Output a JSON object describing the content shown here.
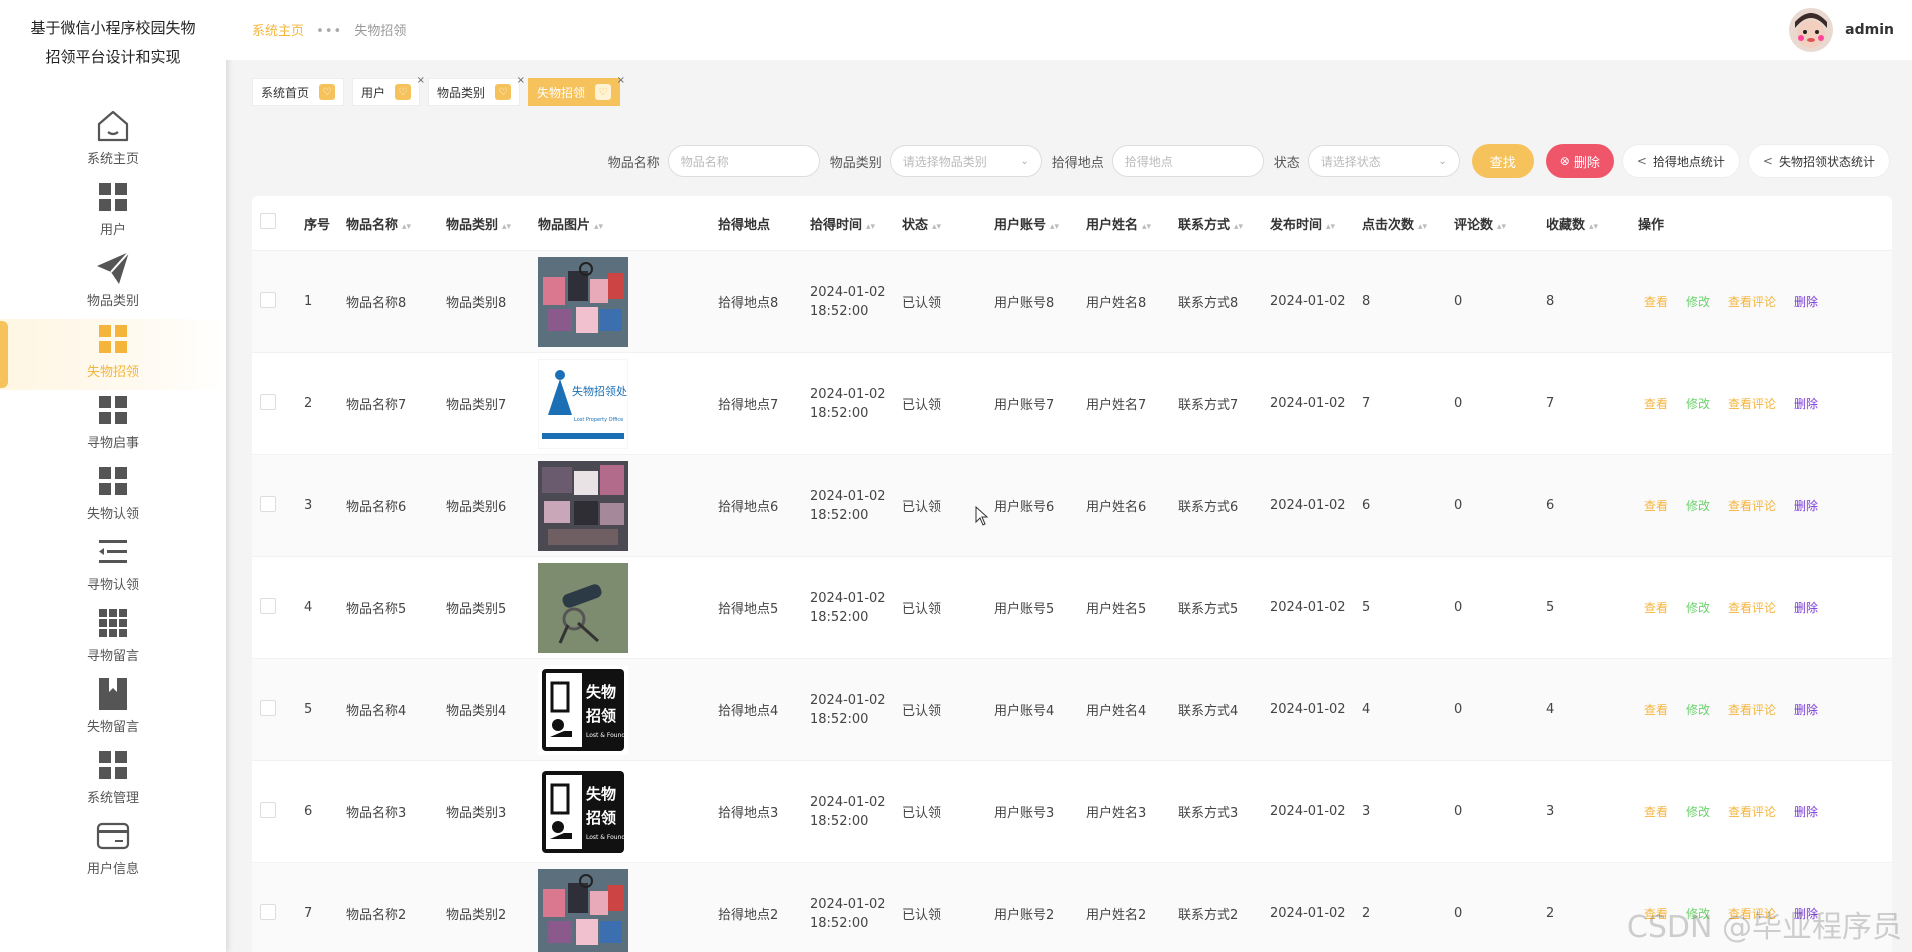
{
  "app": {
    "title_line1": "基于微信小程序校园失物",
    "title_line2": "招领平台设计和实现"
  },
  "sidebar": {
    "items": [
      {
        "label": "系统主页",
        "icon": "home-icon"
      },
      {
        "label": "用户",
        "icon": "grid-icon"
      },
      {
        "label": "物品类别",
        "icon": "send-icon"
      },
      {
        "label": "失物招领",
        "icon": "grid-icon",
        "active": true
      },
      {
        "label": "寻物启事",
        "icon": "grid-icon"
      },
      {
        "label": "失物认领",
        "icon": "grid-icon"
      },
      {
        "label": "寻物认领",
        "icon": "list-icon"
      },
      {
        "label": "寻物留言",
        "icon": "apps-icon"
      },
      {
        "label": "失物留言",
        "icon": "bookmark-icon"
      },
      {
        "label": "系统管理",
        "icon": "grid-icon"
      },
      {
        "label": "用户信息",
        "icon": "card-icon"
      }
    ]
  },
  "breadcrumb": {
    "home": "系统主页",
    "sep": "•••",
    "current": "失物招领"
  },
  "user": {
    "name": "admin"
  },
  "tags": [
    {
      "label": "系统首页"
    },
    {
      "label": "用户",
      "closable": true
    },
    {
      "label": "物品类别",
      "closable": true
    },
    {
      "label": "失物招领",
      "closable": true,
      "active": true
    }
  ],
  "search": {
    "name_label": "物品名称",
    "name_placeholder": "物品名称",
    "category_label": "物品类别",
    "category_placeholder": "请选择物品类别",
    "place_label": "拾得地点",
    "place_placeholder": "拾得地点",
    "status_label": "状态",
    "status_placeholder": "请选择状态",
    "search_btn": "查找",
    "delete_btn": "删除",
    "stat_place_btn": "拾得地点统计",
    "stat_status_btn": "失物招领状态统计"
  },
  "table": {
    "headers": [
      "序号",
      "物品名称",
      "物品类别",
      "物品图片",
      "拾得地点",
      "拾得时间",
      "状态",
      "用户账号",
      "用户姓名",
      "联系方式",
      "发布时间",
      "点击次数",
      "评论数",
      "收藏数",
      "操作"
    ],
    "actions": {
      "view": "查看",
      "edit": "修改",
      "comments": "查看评论",
      "delete": "删除"
    },
    "rows": [
      {
        "idx": "1",
        "name": "物品名称8",
        "cat": "物品类别8",
        "img": "bags",
        "place": "拾得地点8",
        "date": "2024-01-02",
        "time": "18:52:00",
        "status": "已认领",
        "acct": "用户账号8",
        "uname": "用户姓名8",
        "contact": "联系方式8",
        "pub": "2024-01-02",
        "clicks": "8",
        "cmts": "0",
        "favs": "8"
      },
      {
        "idx": "2",
        "name": "物品名称7",
        "cat": "物品类别7",
        "img": "office",
        "place": "拾得地点7",
        "date": "2024-01-02",
        "time": "18:52:00",
        "status": "已认领",
        "acct": "用户账号7",
        "uname": "用户姓名7",
        "contact": "联系方式7",
        "pub": "2024-01-02",
        "clicks": "7",
        "cmts": "0",
        "favs": "7"
      },
      {
        "idx": "3",
        "name": "物品名称6",
        "cat": "物品类别6",
        "img": "pile",
        "place": "拾得地点6",
        "date": "2024-01-02",
        "time": "18:52:00",
        "status": "已认领",
        "acct": "用户账号6",
        "uname": "用户姓名6",
        "contact": "联系方式6",
        "pub": "2024-01-02",
        "clicks": "6",
        "cmts": "0",
        "favs": "6"
      },
      {
        "idx": "4",
        "name": "物品名称5",
        "cat": "物品类别5",
        "img": "keys",
        "place": "拾得地点5",
        "date": "2024-01-02",
        "time": "18:52:00",
        "status": "已认领",
        "acct": "用户账号5",
        "uname": "用户姓名5",
        "contact": "联系方式5",
        "pub": "2024-01-02",
        "clicks": "5",
        "cmts": "0",
        "favs": "5"
      },
      {
        "idx": "5",
        "name": "物品名称4",
        "cat": "物品类别4",
        "img": "sign",
        "place": "拾得地点4",
        "date": "2024-01-02",
        "time": "18:52:00",
        "status": "已认领",
        "acct": "用户账号4",
        "uname": "用户姓名4",
        "contact": "联系方式4",
        "pub": "2024-01-02",
        "clicks": "4",
        "cmts": "0",
        "favs": "4"
      },
      {
        "idx": "6",
        "name": "物品名称3",
        "cat": "物品类别3",
        "img": "sign",
        "place": "拾得地点3",
        "date": "2024-01-02",
        "time": "18:52:00",
        "status": "已认领",
        "acct": "用户账号3",
        "uname": "用户姓名3",
        "contact": "联系方式3",
        "pub": "2024-01-02",
        "clicks": "3",
        "cmts": "0",
        "favs": "3"
      },
      {
        "idx": "7",
        "name": "物品名称2",
        "cat": "物品类别2",
        "img": "bags",
        "place": "拾得地点2",
        "date": "2024-01-02",
        "time": "18:52:00",
        "status": "已认领",
        "acct": "用户账号2",
        "uname": "用户姓名2",
        "contact": "联系方式2",
        "pub": "2024-01-02",
        "clicks": "2",
        "cmts": "0",
        "favs": "2"
      }
    ]
  },
  "sign_text": {
    "line1": "失物",
    "line2": "招领",
    "sub": "Lost & Found"
  },
  "office_sign": {
    "text": "失物招领处",
    "sub": "Lost Property Office"
  },
  "watermark": "CSDN @毕业程序员",
  "colors": {
    "accent": "#f5c25b",
    "danger": "#f0566a",
    "edit": "#6bd26b",
    "delete": "#7a3bd8"
  }
}
